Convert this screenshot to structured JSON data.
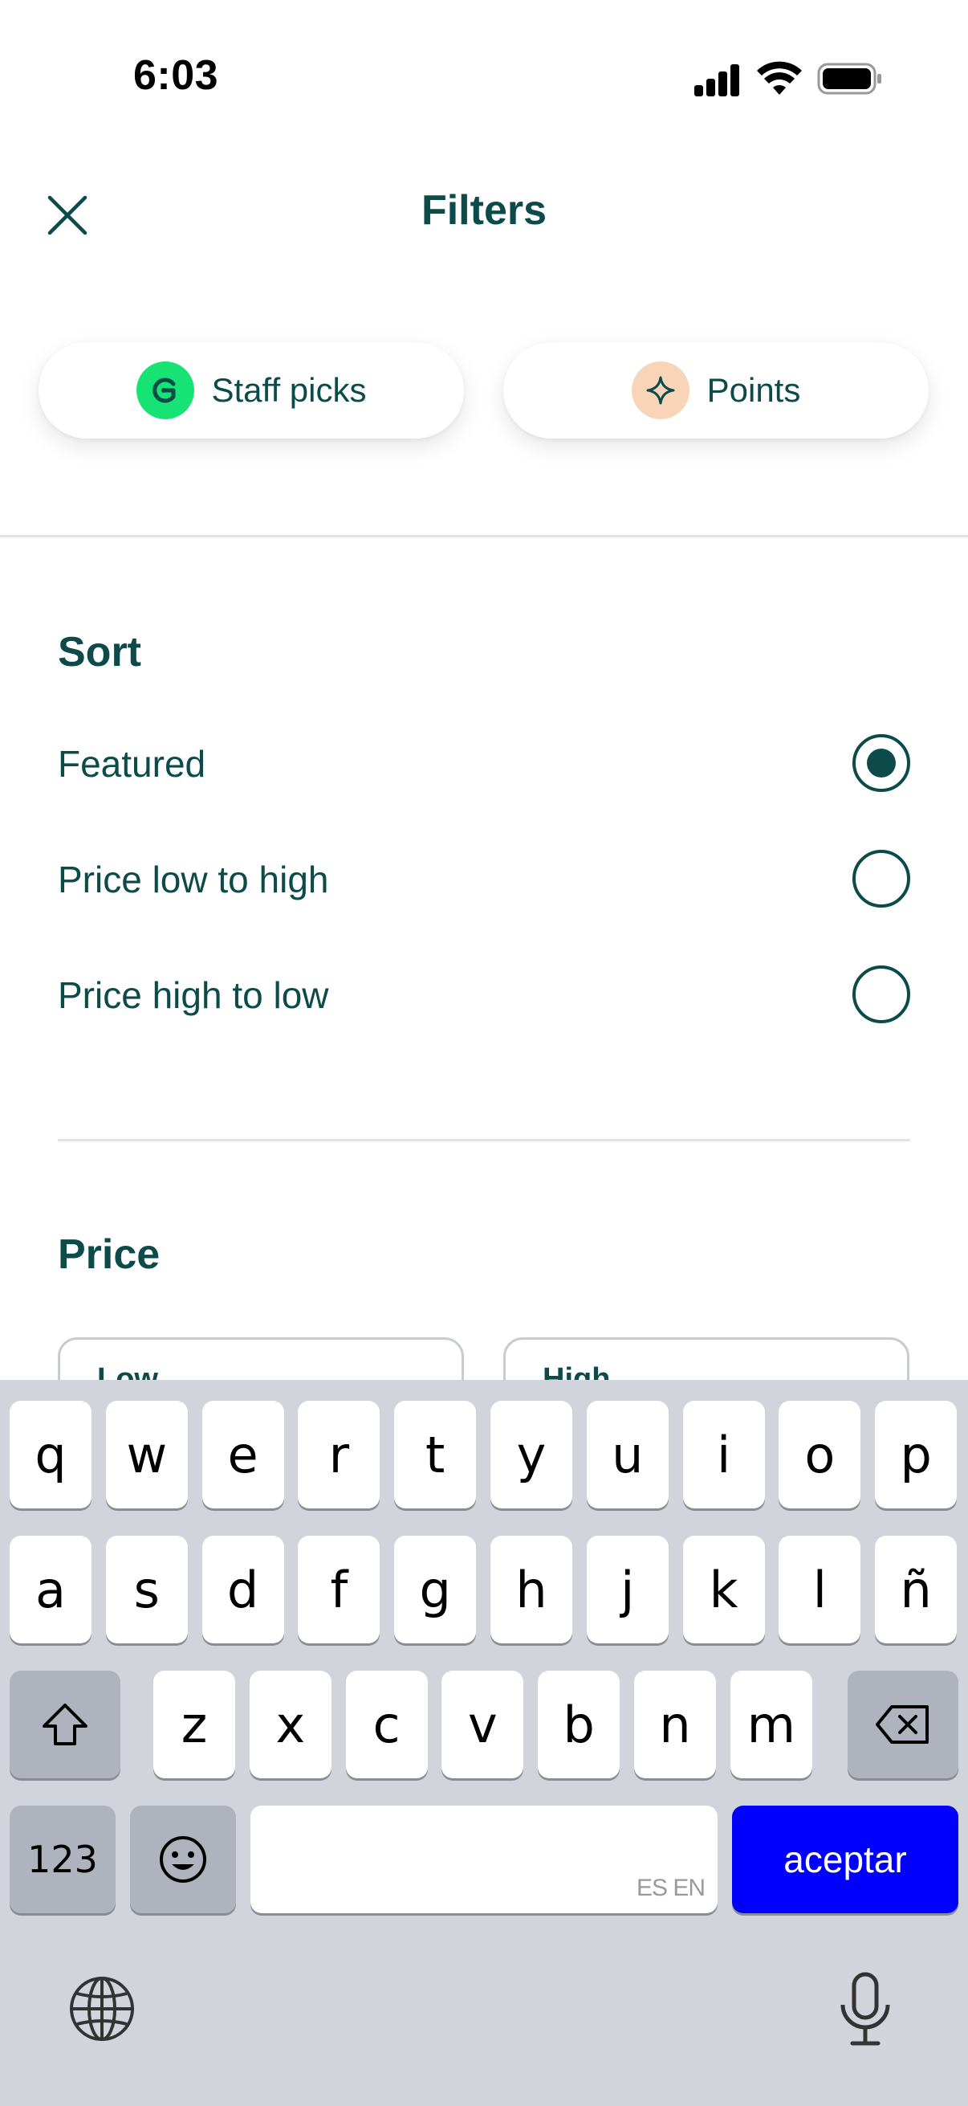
{
  "status_bar": {
    "time": "6:03"
  },
  "header": {
    "title": "Filters"
  },
  "chips": [
    {
      "label": "Staff picks",
      "icon": "staff-picks-icon",
      "icon_bg": "#17e374"
    },
    {
      "label": "Points",
      "icon": "sparkle-icon",
      "icon_bg": "#f8d5b8"
    }
  ],
  "sort": {
    "title": "Sort",
    "options": [
      {
        "label": "Featured",
        "selected": true
      },
      {
        "label": "Price low to high",
        "selected": false
      },
      {
        "label": "Price high to low",
        "selected": false
      }
    ]
  },
  "price": {
    "title": "Price",
    "low_label": "Low",
    "high_label": "High"
  },
  "keyboard": {
    "row1": [
      "q",
      "w",
      "e",
      "r",
      "t",
      "y",
      "u",
      "i",
      "o",
      "p"
    ],
    "row2": [
      "a",
      "s",
      "d",
      "f",
      "g",
      "h",
      "j",
      "k",
      "l",
      "ñ"
    ],
    "row3": [
      "z",
      "x",
      "c",
      "v",
      "b",
      "n",
      "m"
    ],
    "numbers_key": "123",
    "language_hint": "ES EN",
    "return_key": "aceptar"
  },
  "colors": {
    "primary_text": "#0d4a4a",
    "return_key": "#0000ff",
    "keyboard_bg": "#d1d4db"
  }
}
